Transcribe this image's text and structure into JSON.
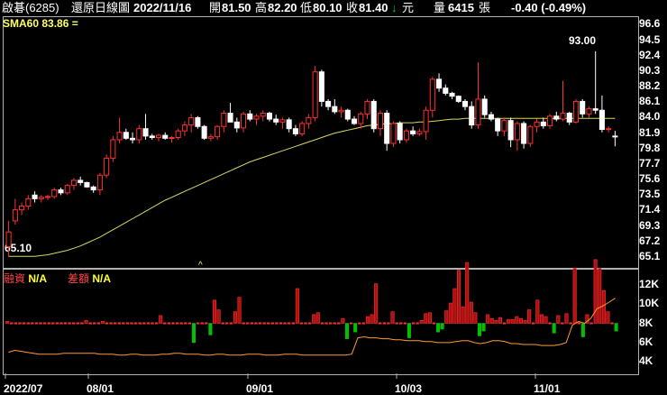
{
  "header": {
    "name": "啟碁(6285)",
    "mode": "還原日線圖",
    "date": "2022/11/16",
    "open_label": "開",
    "open": "81.50",
    "high_label": "高",
    "high": "82.20",
    "low_label": "低",
    "low": "80.10",
    "close_label": "收",
    "close": "81.40",
    "arrow": "↓",
    "unit": "元",
    "vol_label": "量",
    "vol": "6415",
    "vol_unit": "張",
    "change": "-0.40 (-0.49%)"
  },
  "sma": {
    "label": "SMA60 83.86 ="
  },
  "price_axis": [
    "96.6",
    "94.5",
    "92.4",
    "90.3",
    "88.2",
    "86.1",
    "84.0",
    "81.9",
    "79.8",
    "77.7",
    "75.6",
    "73.5",
    "71.4",
    "69.3",
    "67.2",
    "65.1"
  ],
  "annot": {
    "high": "93.00",
    "low": "65.10"
  },
  "sub": {
    "l_label": "融資",
    "l_val": "N/A",
    "r_label": "差額",
    "r_val": "N/A",
    "axis": [
      "12K",
      "10K",
      "8K",
      "6K",
      "4K"
    ]
  },
  "x_axis": [
    "2022/07",
    "08/01",
    "09/01",
    "10/03",
    "11/01"
  ],
  "colors": {
    "up": "#ff3030",
    "down": "#ffffff",
    "down_fill": "#000000",
    "sma": "#d8d860",
    "green": "#00c000",
    "orange": "#ff9933"
  },
  "chart_data": {
    "type": "candlestick",
    "ylim": [
      64.0,
      97.5
    ],
    "candles": [
      [
        66.5,
        65.1,
        70.0,
        68.5
      ],
      [
        70.0,
        69.5,
        73.0,
        71.5
      ],
      [
        71.5,
        70.8,
        72.5,
        72.0
      ],
      [
        72.0,
        71.5,
        73.5,
        73.0
      ],
      [
        73.5,
        72.5,
        74.0,
        73.0
      ],
      [
        73.0,
        72.5,
        73.5,
        73.2
      ],
      [
        73.2,
        72.8,
        73.5,
        73.3
      ],
      [
        73.3,
        73.0,
        74.5,
        74.2
      ],
      [
        74.2,
        73.5,
        74.5,
        73.8
      ],
      [
        73.8,
        73.5,
        75.0,
        74.8
      ],
      [
        74.8,
        74.2,
        75.8,
        75.5
      ],
      [
        75.5,
        74.8,
        76.0,
        75.2
      ],
      [
        75.2,
        74.5,
        75.3,
        74.6
      ],
      [
        74.6,
        73.8,
        74.8,
        74.2
      ],
      [
        74.2,
        73.5,
        76.5,
        76.2
      ],
      [
        76.2,
        75.8,
        79.0,
        78.5
      ],
      [
        78.5,
        78.0,
        81.5,
        81.0
      ],
      [
        81.0,
        80.5,
        84.0,
        82.0
      ],
      [
        82.0,
        81.0,
        82.5,
        81.2
      ],
      [
        81.2,
        80.5,
        82.0,
        81.0
      ],
      [
        81.0,
        80.5,
        83.0,
        82.5
      ],
      [
        82.5,
        81.0,
        84.5,
        81.5
      ],
      [
        81.5,
        81.0,
        81.8,
        81.3
      ],
      [
        81.3,
        80.8,
        81.8,
        81.6
      ],
      [
        81.6,
        81.0,
        82.0,
        81.2
      ],
      [
        81.2,
        80.6,
        81.5,
        81.3
      ],
      [
        81.3,
        81.0,
        82.5,
        82.2
      ],
      [
        82.2,
        81.5,
        83.5,
        83.0
      ],
      [
        83.0,
        82.0,
        84.5,
        84.0
      ],
      [
        84.0,
        82.5,
        84.2,
        82.8
      ],
      [
        82.8,
        81.0,
        83.0,
        81.2
      ],
      [
        81.2,
        80.8,
        81.8,
        81.4
      ],
      [
        81.4,
        81.0,
        83.0,
        82.8
      ],
      [
        82.8,
        82.0,
        85.0,
        84.6
      ],
      [
        84.6,
        84.0,
        86.0,
        83.4
      ],
      [
        83.4,
        82.0,
        84.0,
        82.6
      ],
      [
        82.6,
        82.0,
        84.8,
        84.5
      ],
      [
        84.5,
        83.5,
        85.0,
        83.8
      ],
      [
        83.8,
        83.0,
        84.5,
        84.2
      ],
      [
        84.2,
        83.5,
        85.0,
        84.6
      ],
      [
        84.6,
        83.5,
        84.8,
        83.8
      ],
      [
        83.8,
        83.0,
        84.4,
        83.4
      ],
      [
        83.4,
        82.5,
        84.0,
        83.7
      ],
      [
        83.7,
        82.0,
        84.0,
        82.5
      ],
      [
        82.5,
        81.5,
        83.0,
        81.8
      ],
      [
        81.8,
        81.5,
        83.5,
        83.2
      ],
      [
        83.2,
        82.5,
        84.5,
        84.0
      ],
      [
        84.0,
        83.5,
        91.0,
        90.2
      ],
      [
        90.2,
        85.5,
        90.5,
        86.2
      ],
      [
        86.2,
        85.0,
        86.5,
        85.5
      ],
      [
        85.5,
        84.5,
        86.5,
        84.8
      ],
      [
        84.8,
        84.0,
        85.5,
        85.0
      ],
      [
        85.0,
        83.5,
        85.2,
        83.8
      ],
      [
        83.8,
        83.0,
        84.2,
        83.2
      ],
      [
        83.2,
        82.5,
        84.8,
        84.5
      ],
      [
        84.5,
        83.8,
        86.5,
        86.2
      ],
      [
        86.2,
        82.0,
        86.5,
        82.5
      ],
      [
        82.5,
        81.5,
        85.0,
        84.6
      ],
      [
        84.6,
        79.5,
        85.0,
        80.5
      ],
      [
        80.5,
        80.0,
        83.5,
        83.2
      ],
      [
        83.2,
        80.5,
        83.5,
        81.0
      ],
      [
        81.0,
        80.6,
        82.5,
        82.2
      ],
      [
        82.2,
        81.5,
        82.8,
        81.8
      ],
      [
        81.8,
        81.5,
        82.5,
        82.1
      ],
      [
        82.1,
        81.0,
        85.5,
        85.0
      ],
      [
        85.0,
        84.0,
        89.5,
        89.2
      ],
      [
        89.2,
        87.5,
        90.0,
        88.0
      ],
      [
        88.0,
        87.0,
        88.5,
        87.3
      ],
      [
        87.3,
        86.5,
        87.5,
        86.9
      ],
      [
        86.9,
        86.0,
        87.0,
        86.2
      ],
      [
        86.2,
        85.0,
        86.5,
        85.5
      ],
      [
        85.5,
        82.5,
        86.2,
        83.0
      ],
      [
        83.0,
        82.5,
        91.5,
        86.5
      ],
      [
        86.5,
        84.0,
        87.0,
        84.4
      ],
      [
        84.4,
        83.5,
        84.8,
        83.8
      ],
      [
        83.8,
        81.5,
        84.0,
        82.2
      ],
      [
        82.2,
        81.5,
        84.0,
        83.6
      ],
      [
        83.6,
        80.0,
        84.0,
        81.0
      ],
      [
        81.0,
        79.5,
        83.5,
        83.2
      ],
      [
        83.2,
        79.8,
        83.5,
        80.5
      ],
      [
        80.5,
        80.0,
        83.0,
        82.8
      ],
      [
        82.8,
        82.0,
        83.8,
        83.4
      ],
      [
        83.4,
        82.5,
        84.0,
        82.9
      ],
      [
        82.9,
        82.5,
        84.5,
        84.2
      ],
      [
        84.2,
        83.5,
        84.8,
        83.8
      ],
      [
        83.8,
        83.5,
        89.0,
        84.6
      ],
      [
        84.6,
        83.0,
        84.8,
        83.4
      ],
      [
        83.4,
        83.2,
        86.5,
        86.2
      ],
      [
        86.2,
        84.0,
        86.5,
        84.5
      ],
      [
        84.5,
        84.0,
        85.5,
        85.2
      ],
      [
        85.2,
        84.5,
        93.0,
        85.0
      ],
      [
        85.0,
        82.0,
        87.0,
        82.4
      ],
      [
        82.4,
        82.0,
        82.8,
        82.5
      ],
      [
        81.5,
        80.1,
        82.2,
        81.4
      ]
    ],
    "sma": [
      65.2,
      65.2,
      65.2,
      65.2,
      65.2,
      65.3,
      65.4,
      65.6,
      65.8,
      66.0,
      66.3,
      66.6,
      67.0,
      67.4,
      67.8,
      68.3,
      68.8,
      69.3,
      69.8,
      70.3,
      70.8,
      71.3,
      71.8,
      72.3,
      72.8,
      73.2,
      73.6,
      74.0,
      74.4,
      74.8,
      75.2,
      75.6,
      76.0,
      76.4,
      76.8,
      77.2,
      77.6,
      78.0,
      78.3,
      78.6,
      78.9,
      79.2,
      79.5,
      79.8,
      80.1,
      80.4,
      80.7,
      81.0,
      81.3,
      81.6,
      81.9,
      82.1,
      82.3,
      82.5,
      82.7,
      82.9,
      83.0,
      83.1,
      83.2,
      83.2,
      83.3,
      83.3,
      83.3,
      83.4,
      83.4,
      83.5,
      83.6,
      83.7,
      83.8,
      83.8,
      83.9,
      83.9,
      83.9,
      83.9,
      83.9,
      83.9,
      83.9,
      83.9,
      83.9,
      83.9,
      83.9,
      83.9,
      83.9,
      83.9,
      83.9,
      83.9,
      83.9,
      83.9,
      83.9,
      83.9,
      83.9,
      83.9,
      83.9,
      83.9
    ],
    "sub_ylim": [
      3000,
      13000
    ],
    "sub_bars": [
      200,
      0,
      0,
      0,
      0,
      0,
      0,
      0,
      0,
      0,
      0,
      0,
      0,
      0,
      0,
      0,
      0,
      0,
      0,
      300,
      0,
      0,
      0,
      200,
      0,
      0,
      0,
      0,
      0,
      0,
      0,
      0,
      0,
      0,
      0,
      0,
      0,
      800,
      0,
      0,
      0,
      0,
      0,
      0,
      0,
      -2000,
      0,
      0,
      0,
      -1200,
      2400,
      1400,
      0,
      0,
      0,
      1200,
      2700,
      0,
      0,
      0,
      0,
      0,
      0,
      0,
      0,
      0,
      0,
      0,
      0,
      0,
      3600,
      0,
      0,
      0,
      900,
      1100,
      0,
      0,
      0,
      0,
      0,
      500,
      -1600,
      0,
      -900,
      0,
      0,
      700,
      900,
      4100,
      0,
      0,
      0,
      1200,
      0,
      0,
      0,
      -1500,
      0,
      0,
      300,
      1000,
      1100,
      0,
      -900,
      -600,
      1300,
      2100,
      3600,
      5500,
      1700,
      6300,
      2200,
      1100,
      -1300,
      -800,
      900,
      500,
      300,
      600,
      0,
      400,
      400,
      700,
      500,
      300,
      1400,
      0,
      2400,
      900,
      700,
      0,
      -1000,
      800,
      0,
      1000,
      0,
      5700,
      0,
      -1400,
      900,
      0,
      6600,
      5700,
      3400,
      1200,
      0,
      -800
    ],
    "sub_line": [
      5000,
      5200,
      5100,
      5000,
      4900,
      4800,
      4800,
      4800,
      4800,
      4900,
      4900,
      4900,
      4900,
      4900,
      4900,
      4800,
      4800,
      4800,
      4700,
      4700,
      4800,
      4800,
      4700,
      4700,
      4700,
      4800,
      4800,
      4900,
      4900,
      4800,
      4800,
      4800,
      4700,
      4700,
      4800,
      4800,
      4700,
      4700,
      4700,
      4800,
      4800,
      4800,
      4700,
      4700,
      4700,
      4800,
      4800,
      4800,
      4700,
      4700,
      4700,
      4700,
      4700,
      4700,
      4700,
      4700,
      4800,
      6500,
      6600,
      6500,
      6500,
      6400,
      6400,
      6300,
      6300,
      6200,
      6200,
      6200,
      6100,
      6100,
      6000,
      6000,
      6000,
      6100,
      6200,
      6200,
      6000,
      5900,
      6000,
      6200,
      6200,
      6100,
      5900,
      5900,
      5800,
      5800,
      5800,
      5700,
      5700,
      5700,
      5800,
      6000,
      7800,
      8200,
      8000,
      8500,
      9500,
      9800,
      10200,
      10600
    ]
  }
}
